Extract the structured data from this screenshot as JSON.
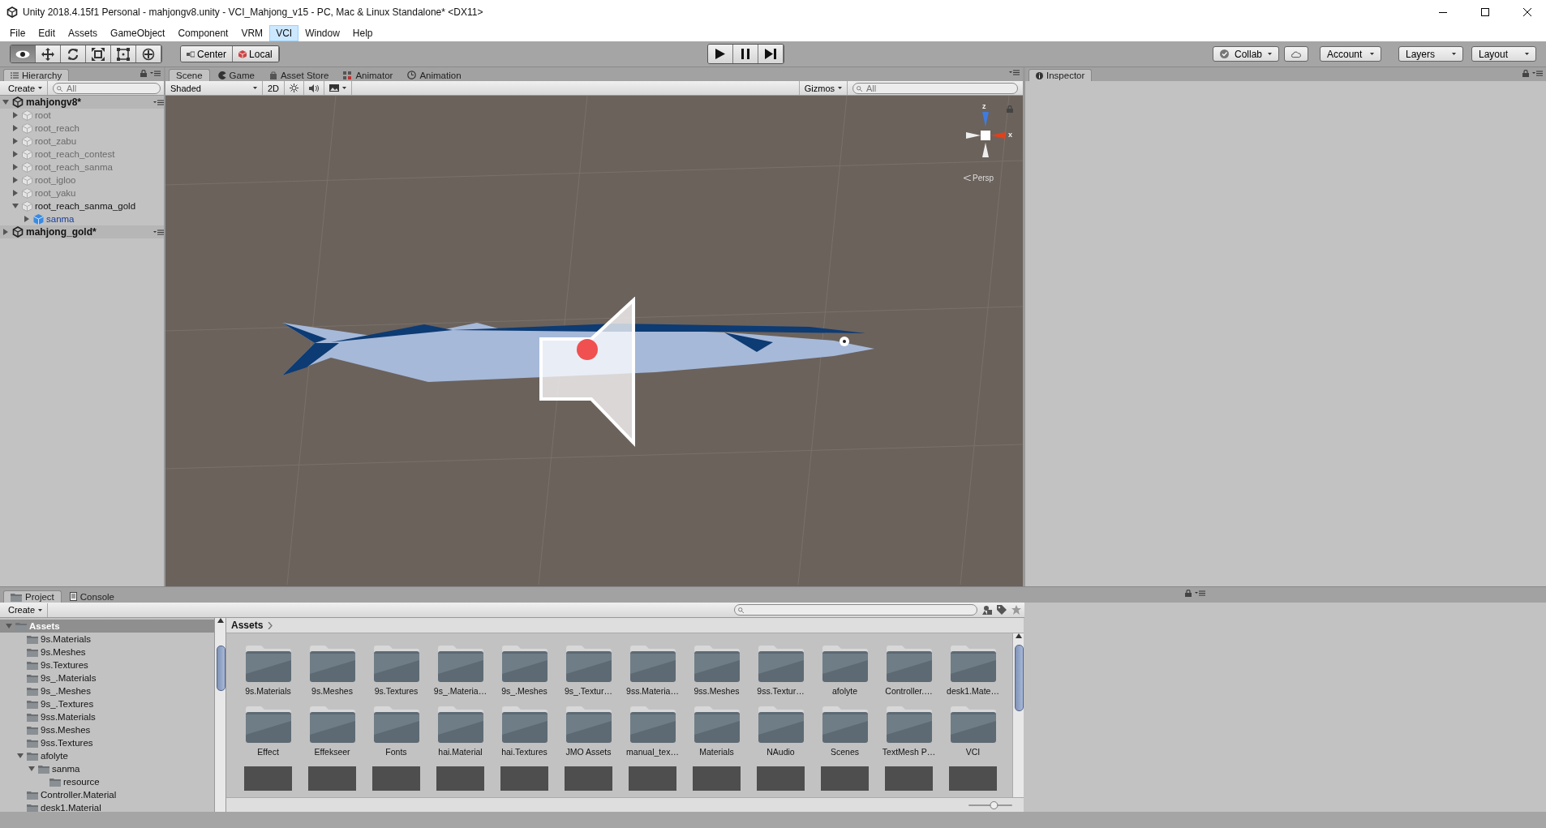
{
  "window": {
    "title": "Unity 2018.4.15f1 Personal - mahjongv8.unity - VCI_Mahjong_v15 - PC, Mac & Linux Standalone* <DX11>"
  },
  "menu": [
    {
      "label": "File",
      "selected": false
    },
    {
      "label": "Edit",
      "selected": false
    },
    {
      "label": "Assets",
      "selected": false
    },
    {
      "label": "GameObject",
      "selected": false
    },
    {
      "label": "Component",
      "selected": false
    },
    {
      "label": "VRM",
      "selected": false
    },
    {
      "label": "VCI",
      "selected": true
    },
    {
      "label": "Window",
      "selected": false
    },
    {
      "label": "Help",
      "selected": false
    }
  ],
  "toolbar": {
    "tools": [
      {
        "kind": "view",
        "selected": true
      },
      {
        "kind": "move",
        "selected": false
      },
      {
        "kind": "rotate",
        "selected": false
      },
      {
        "kind": "scale",
        "selected": false
      },
      {
        "kind": "rect",
        "selected": false
      },
      {
        "kind": "transform",
        "selected": false
      }
    ],
    "pivot": [
      {
        "kind": "center",
        "label": "Center"
      },
      {
        "kind": "local",
        "label": "Local"
      }
    ],
    "play": [
      {
        "kind": "play"
      },
      {
        "kind": "pause"
      },
      {
        "kind": "step"
      }
    ],
    "collab": "Collab",
    "account": "Account",
    "layers": "Layers",
    "layout": "Layout"
  },
  "hierarchy": {
    "tab": "Hierarchy",
    "create": "Create",
    "search": {
      "placeholder": "All"
    },
    "scenes": [
      {
        "name": "mahjongv8*",
        "expanded": true,
        "children": [
          {
            "name": "root",
            "kind": "object",
            "active": false,
            "expanded": false
          },
          {
            "name": "root_reach",
            "kind": "object",
            "active": false,
            "expanded": false
          },
          {
            "name": "root_zabu",
            "kind": "object",
            "active": false,
            "expanded": false
          },
          {
            "name": "root_reach_contest",
            "kind": "object",
            "active": false,
            "expanded": false
          },
          {
            "name": "root_reach_sanma",
            "kind": "object",
            "active": false,
            "expanded": false
          },
          {
            "name": "root_igloo",
            "kind": "object",
            "active": false,
            "expanded": false
          },
          {
            "name": "root_yaku",
            "kind": "object",
            "active": false,
            "expanded": false
          },
          {
            "name": "root_reach_sanma_gold",
            "kind": "object",
            "active": true,
            "expanded": true,
            "children": [
              {
                "name": "sanma",
                "kind": "prefab",
                "active": true,
                "expanded": false
              }
            ]
          }
        ]
      },
      {
        "name": "mahjong_gold*",
        "expanded": false
      }
    ]
  },
  "scene_view": {
    "tabs": [
      {
        "label": "Scene",
        "kind": "scene",
        "selected": true
      },
      {
        "label": "Game",
        "kind": "game",
        "selected": false
      },
      {
        "label": "Asset Store",
        "kind": "store",
        "selected": false
      },
      {
        "label": "Animator",
        "kind": "animator",
        "selected": false
      },
      {
        "label": "Animation",
        "kind": "animation",
        "selected": false
      }
    ],
    "shading": "Shaded",
    "mode_2d": "2D",
    "audio_on": false,
    "gizmos": "Gizmos",
    "search": {
      "placeholder": "All"
    },
    "axis_z": "z",
    "axis_x": "x",
    "projection": "Persp"
  },
  "inspector": {
    "tab": "Inspector"
  },
  "project": {
    "tabs": [
      {
        "label": "Project",
        "kind": "project",
        "selected": true
      },
      {
        "label": "Console",
        "kind": "console",
        "selected": false
      }
    ],
    "create": "Create",
    "tree": [
      {
        "name": "Assets",
        "selected": true,
        "expanded": true,
        "children": [
          {
            "name": "9s.Materials",
            "selected": false
          },
          {
            "name": "9s.Meshes",
            "selected": false
          },
          {
            "name": "9s.Textures",
            "selected": false
          },
          {
            "name": "9s_.Materials",
            "selected": false
          },
          {
            "name": "9s_.Meshes",
            "selected": false
          },
          {
            "name": "9s_.Textures",
            "selected": false
          },
          {
            "name": "9ss.Materials",
            "selected": false
          },
          {
            "name": "9ss.Meshes",
            "selected": false
          },
          {
            "name": "9ss.Textures",
            "selected": false
          },
          {
            "name": "afolyte",
            "selected": false,
            "expanded": true,
            "children": [
              {
                "name": "sanma",
                "selected": false,
                "expanded": true,
                "children": [
                  {
                    "name": "resource",
                    "selected": false
                  }
                ]
              }
            ]
          },
          {
            "name": "Controller.Material",
            "selected": false
          },
          {
            "name": "desk1.Material",
            "selected": false
          }
        ]
      }
    ],
    "breadcrumb": "Assets",
    "zoom": {
      "level": 0.6
    },
    "items": [
      "9s.Materials",
      "9s.Meshes",
      "9s.Textures",
      "9s_.Materia…",
      "9s_.Meshes",
      "9s_.Textur…",
      "9ss.Materia…",
      "9ss.Meshes",
      "9ss.Textur…",
      "afolyte",
      "Controller.…",
      "desk1.Mate…",
      "Effect",
      "Effekseer",
      "Fonts",
      "hai.Material",
      "hai.Textures",
      "JMO Assets",
      "manual_tex…",
      "Materials",
      "NAudio",
      "Scenes",
      "TextMesh P…",
      "VCI"
    ]
  }
}
